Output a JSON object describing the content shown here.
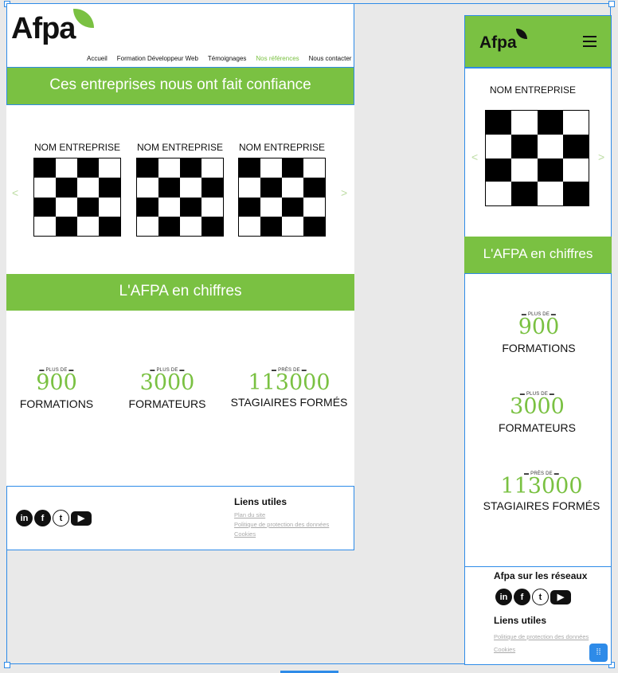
{
  "brand": {
    "logo_text": "Afpa",
    "green": "#7ac142"
  },
  "nav": {
    "items": [
      "Accueil",
      "Formation Développeur Web",
      "Témoignages",
      "Nos références",
      "Nous contacter"
    ],
    "active": "Nos références"
  },
  "references": {
    "title": "Ces entreprises nous ont fait confiance",
    "company_label": "NOM ENTREPRISE",
    "prev": "<",
    "next": ">"
  },
  "numbers": {
    "title": "L'AFPA en chiffres",
    "stats": [
      {
        "prefix": "PLUS DE",
        "value": "900",
        "label": "FORMATIONS"
      },
      {
        "prefix": "PLUS DE",
        "value": "3000",
        "label": "FORMATEURS"
      },
      {
        "prefix": "PRÈS DE",
        "value": "113000",
        "label": "STAGIAIRES FORMÉS"
      }
    ]
  },
  "footer": {
    "social_title": "Afpa sur les réseaux",
    "links_title": "Liens utiles",
    "links": [
      "Plan du site",
      "Politique de protection des données",
      "Cookies"
    ],
    "mobile_links": [
      "Politique de protection des données",
      "Cookies"
    ],
    "social_icons": [
      "linkedin-icon",
      "facebook-icon",
      "twitter-icon",
      "youtube-icon"
    ]
  }
}
